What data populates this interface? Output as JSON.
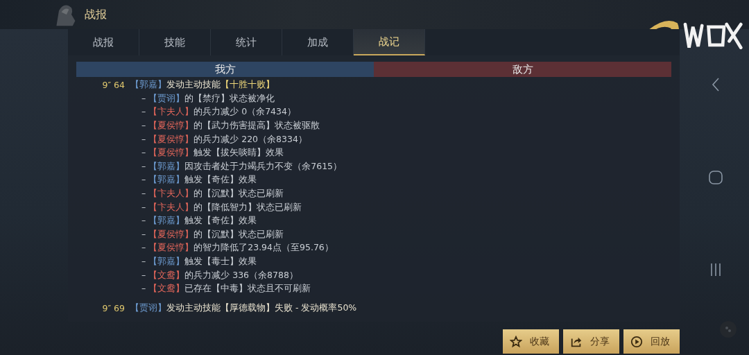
{
  "header": {
    "title": "战报"
  },
  "tabs": [
    {
      "label": "战报",
      "selected": false
    },
    {
      "label": "技能",
      "selected": false
    },
    {
      "label": "统计",
      "selected": false
    },
    {
      "label": "加成",
      "selected": false
    },
    {
      "label": "战记",
      "selected": true
    }
  ],
  "columns": [
    {
      "label": "我方",
      "kind": "ally"
    },
    {
      "label": "敌方",
      "kind": "enemy"
    }
  ],
  "log": [
    {
      "time": "9″ 64",
      "parts": [
        {
          "kind": "ally",
          "text": "【郭嘉】"
        },
        {
          "kind": "text",
          "text": "发动主动技能"
        },
        {
          "kind": "skill",
          "text": "【十胜十败】"
        }
      ],
      "children": [
        {
          "parts": [
            {
              "kind": "text",
              "text": "– "
            },
            {
              "kind": "ally",
              "text": "【贾诩】"
            },
            {
              "kind": "text",
              "text": "的【禁疗】状态被净化"
            }
          ]
        },
        {
          "parts": [
            {
              "kind": "text",
              "text": "– "
            },
            {
              "kind": "enemy",
              "text": "【卞夫人】"
            },
            {
              "kind": "text",
              "text": "的兵力减少 0（余7434）"
            }
          ]
        },
        {
          "parts": [
            {
              "kind": "text",
              "text": "– "
            },
            {
              "kind": "enemy",
              "text": "【夏侯惇】"
            },
            {
              "kind": "text",
              "text": "的【武力伤害提高】状态被驱散"
            }
          ]
        },
        {
          "parts": [
            {
              "kind": "text",
              "text": "– "
            },
            {
              "kind": "enemy",
              "text": "【夏侯惇】"
            },
            {
              "kind": "text",
              "text": "的兵力减少 220（余8334）"
            }
          ]
        },
        {
          "parts": [
            {
              "kind": "text",
              "text": "– "
            },
            {
              "kind": "enemy",
              "text": "【夏侯惇】"
            },
            {
              "kind": "text",
              "text": "触发【拔矢啖睛】效果"
            }
          ]
        },
        {
          "parts": [
            {
              "kind": "text",
              "text": "– "
            },
            {
              "kind": "ally",
              "text": "【郭嘉】"
            },
            {
              "kind": "text",
              "text": "因攻击者处于力竭兵力不变（余7615）"
            }
          ]
        },
        {
          "parts": [
            {
              "kind": "text",
              "text": "– "
            },
            {
              "kind": "ally",
              "text": "【郭嘉】"
            },
            {
              "kind": "text",
              "text": "触发【奇佐】效果"
            }
          ]
        },
        {
          "parts": [
            {
              "kind": "text",
              "text": "– "
            },
            {
              "kind": "enemy",
              "text": "【卞夫人】"
            },
            {
              "kind": "text",
              "text": "的【沉默】状态已刷新"
            }
          ]
        },
        {
          "parts": [
            {
              "kind": "text",
              "text": "– "
            },
            {
              "kind": "enemy",
              "text": "【卞夫人】"
            },
            {
              "kind": "text",
              "text": "的【降低智力】状态已刷新"
            }
          ]
        },
        {
          "parts": [
            {
              "kind": "text",
              "text": "– "
            },
            {
              "kind": "ally",
              "text": "【郭嘉】"
            },
            {
              "kind": "text",
              "text": "触发【奇佐】效果"
            }
          ]
        },
        {
          "parts": [
            {
              "kind": "text",
              "text": "– "
            },
            {
              "kind": "enemy",
              "text": "【夏侯惇】"
            },
            {
              "kind": "text",
              "text": "的【沉默】状态已刷新"
            }
          ]
        },
        {
          "parts": [
            {
              "kind": "text",
              "text": "– "
            },
            {
              "kind": "enemy",
              "text": "【夏侯惇】"
            },
            {
              "kind": "text",
              "text": "的智力降低了23.94点（至95.76）"
            }
          ]
        },
        {
          "parts": [
            {
              "kind": "text",
              "text": "– "
            },
            {
              "kind": "ally",
              "text": "【郭嘉】"
            },
            {
              "kind": "text",
              "text": "触发【毒士】效果"
            }
          ]
        },
        {
          "parts": [
            {
              "kind": "text",
              "text": "– "
            },
            {
              "kind": "enemy",
              "text": "【文鸯】"
            },
            {
              "kind": "text",
              "text": "的兵力减少 336（余8788）"
            }
          ]
        },
        {
          "parts": [
            {
              "kind": "text",
              "text": "– "
            },
            {
              "kind": "enemy",
              "text": "【文鸯】"
            },
            {
              "kind": "text",
              "text": "已存在【中毒】状态且不可刷新"
            }
          ]
        }
      ]
    },
    {
      "time": "9″ 69",
      "parts": [
        {
          "kind": "ally",
          "text": "【贾诩】"
        },
        {
          "kind": "text",
          "text": "发动主动技能【厚德载物】失败 - 发动概率50%"
        }
      ]
    }
  ],
  "buttons": [
    {
      "label": "收藏",
      "kind": "star"
    },
    {
      "label": "分享",
      "kind": "share"
    },
    {
      "label": "回放",
      "kind": "play"
    }
  ]
}
